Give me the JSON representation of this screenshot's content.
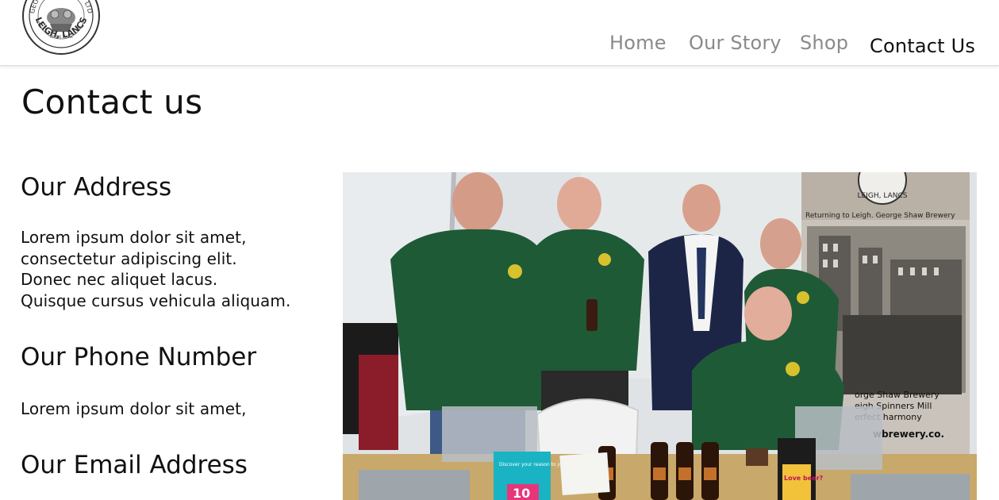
{
  "header": {
    "logo": {
      "text_top": "GEORGE SHAW & CO LTD",
      "text_bottom": "LEIGH, LANCS",
      "trademark": "TRADE MARK"
    },
    "nav": {
      "items": [
        "Home",
        "Our Story",
        "Shop",
        "Contact Us"
      ],
      "active": "Contact Us"
    }
  },
  "page": {
    "title": "Contact us"
  },
  "contact": {
    "address_heading": "Our Address",
    "address_lines": [
      "Lorem ipsum dolor sit amet,",
      "consectetur adipiscing elit.",
      "Donec nec aliquet lacus.",
      "Quisque cursus vehicula aliquam."
    ],
    "phone_heading": "Our Phone Number",
    "phone_text": "Lorem ipsum dolor sit amet,",
    "email_heading": "Our Email Address"
  },
  "photo": {
    "banner_caption": "Returning to Leigh. George Shaw Brewery",
    "banner_lines": [
      "orge Shaw Brewery",
      "eigh Spinners Mill",
      "erfect harmony"
    ],
    "banner_url": "wbrewery.co.",
    "banner_seal": "LEIGH, LANCS",
    "leaflet_text": "Discover your reason to join us",
    "leaflet_number": "10",
    "book_text": "Love beer?"
  },
  "colors": {
    "nav_inactive": "#8a8a8a",
    "nav_active": "#111111",
    "polo_green": "#1f5a36",
    "suit_navy": "#1d2547"
  }
}
